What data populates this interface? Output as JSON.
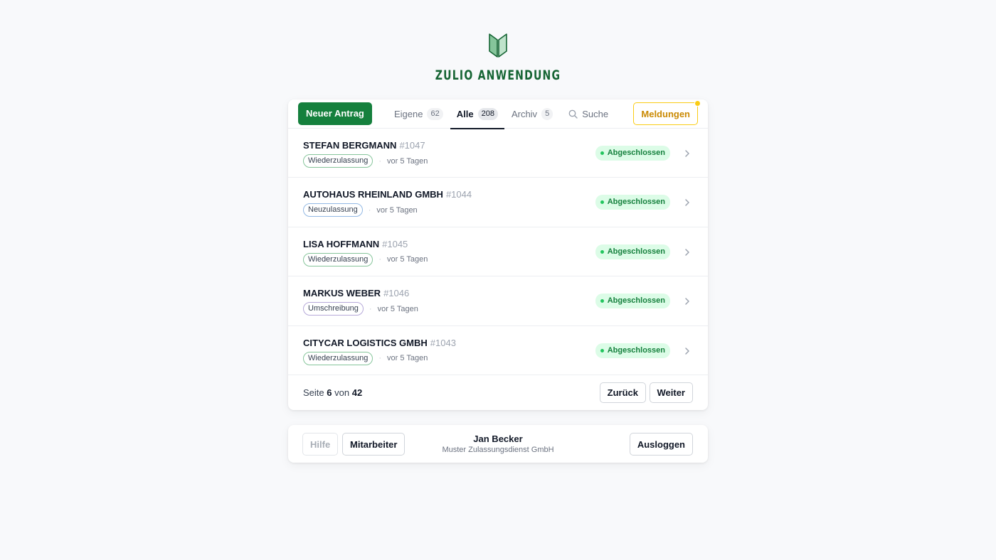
{
  "brand": {
    "name": "ZULIO ANWENDUNG",
    "color": "#166534"
  },
  "toolbar": {
    "new_label": "Neuer Antrag",
    "alerts_label": "Meldungen",
    "search_label": "Suche",
    "tabs": [
      {
        "label": "Eigene",
        "count": "62",
        "active": false
      },
      {
        "label": "Alle",
        "count": "208",
        "active": true
      },
      {
        "label": "Archiv",
        "count": "5",
        "active": false
      }
    ]
  },
  "rows": [
    {
      "name": "STEFAN BERGMANN",
      "id": "#1047",
      "tag": "Wiederzulassung",
      "time": "vor 5 Tagen",
      "status": "Abgeschlossen"
    },
    {
      "name": "AUTOHAUS RHEINLAND GMBH",
      "id": "#1044",
      "tag": "Neuzulassung",
      "time": "vor 5 Tagen",
      "status": "Abgeschlossen"
    },
    {
      "name": "LISA HOFFMANN",
      "id": "#1045",
      "tag": "Wiederzulassung",
      "time": "vor 5 Tagen",
      "status": "Abgeschlossen"
    },
    {
      "name": "MARKUS WEBER",
      "id": "#1046",
      "tag": "Umschreibung",
      "time": "vor 5 Tagen",
      "status": "Abgeschlossen"
    },
    {
      "name": "CITYCAR LOGISTICS GMBH",
      "id": "#1043",
      "tag": "Wiederzulassung",
      "time": "vor 5 Tagen",
      "status": "Abgeschlossen"
    }
  ],
  "pager": {
    "prefix": "Seite",
    "current": "6",
    "middle": "von",
    "total": "42",
    "prev_label": "Zurück",
    "next_label": "Weiter"
  },
  "footer": {
    "help_label": "Hilfe",
    "staff_label": "Mitarbeiter",
    "user_name": "Jan Becker",
    "user_org": "Muster Zulassungsdienst GmbH",
    "logout_label": "Ausloggen"
  },
  "colors": {
    "primary": "#15803d",
    "alert": "#facc15",
    "status_bg": "#dcfce7",
    "status_text": "#15803d"
  },
  "icons": [
    "shield-logo-icon",
    "search-icon",
    "chevron-right-icon",
    "notification-dot"
  ]
}
